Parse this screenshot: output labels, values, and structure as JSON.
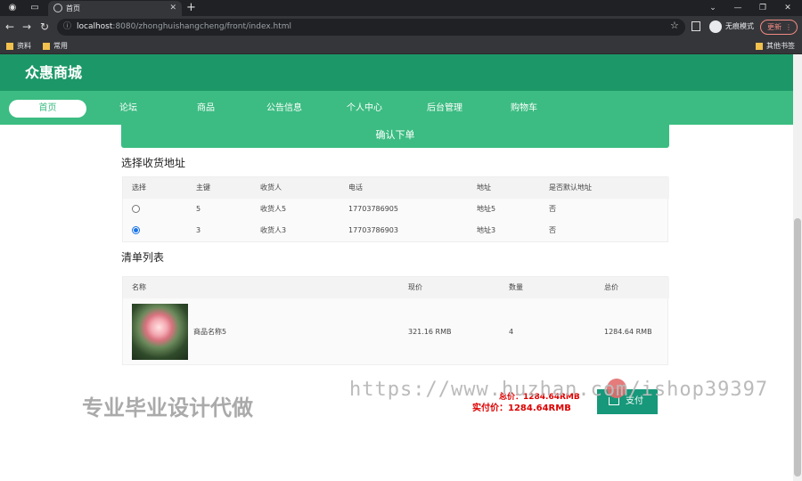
{
  "browser": {
    "tab_title": "首页",
    "url_host": "localhost",
    "url_rest": ":8080/zhonghuishangcheng/front/index.html",
    "incognito_label": "无痕模式",
    "update_label": "更新",
    "bookmarks": [
      "资料",
      "常用"
    ],
    "other_bookmarks": "其他书签"
  },
  "site": {
    "brand": "众惠商城",
    "nav": [
      "首页",
      "论坛",
      "商品",
      "公告信息",
      "个人中心",
      "后台管理",
      "购物车"
    ],
    "active_nav": "首页"
  },
  "order": {
    "confirm_label": "确认下单",
    "address_title": "选择收货地址",
    "address_headers": [
      "选择",
      "主键",
      "收货人",
      "电话",
      "地址",
      "是否默认地址"
    ],
    "addresses": [
      {
        "selected": false,
        "id": "5",
        "name": "收货人5",
        "phone": "17703786905",
        "addr": "地址5",
        "default": "否"
      },
      {
        "selected": true,
        "id": "3",
        "name": "收货人3",
        "phone": "17703786903",
        "addr": "地址3",
        "default": "否"
      }
    ],
    "list_title": "清单列表",
    "list_headers": [
      "名称",
      "现价",
      "数量",
      "总价"
    ],
    "items": [
      {
        "name": "商品名称5",
        "price": "321.16 RMB",
        "qty": "4",
        "total": "1284.64 RMB"
      }
    ],
    "total_label": "总价：1284.64RMB",
    "pay_label": "实付价：1284.64RMB",
    "pay_button": "支付"
  },
  "overlay": {
    "watermark": "https://www.huzhan.com/ishop39397",
    "promo": "专业毕业设计代做"
  },
  "colors": {
    "header": "#1c9868",
    "nav": "#3cbc82",
    "price": "#dd0000",
    "pay_button": "#17987a"
  }
}
